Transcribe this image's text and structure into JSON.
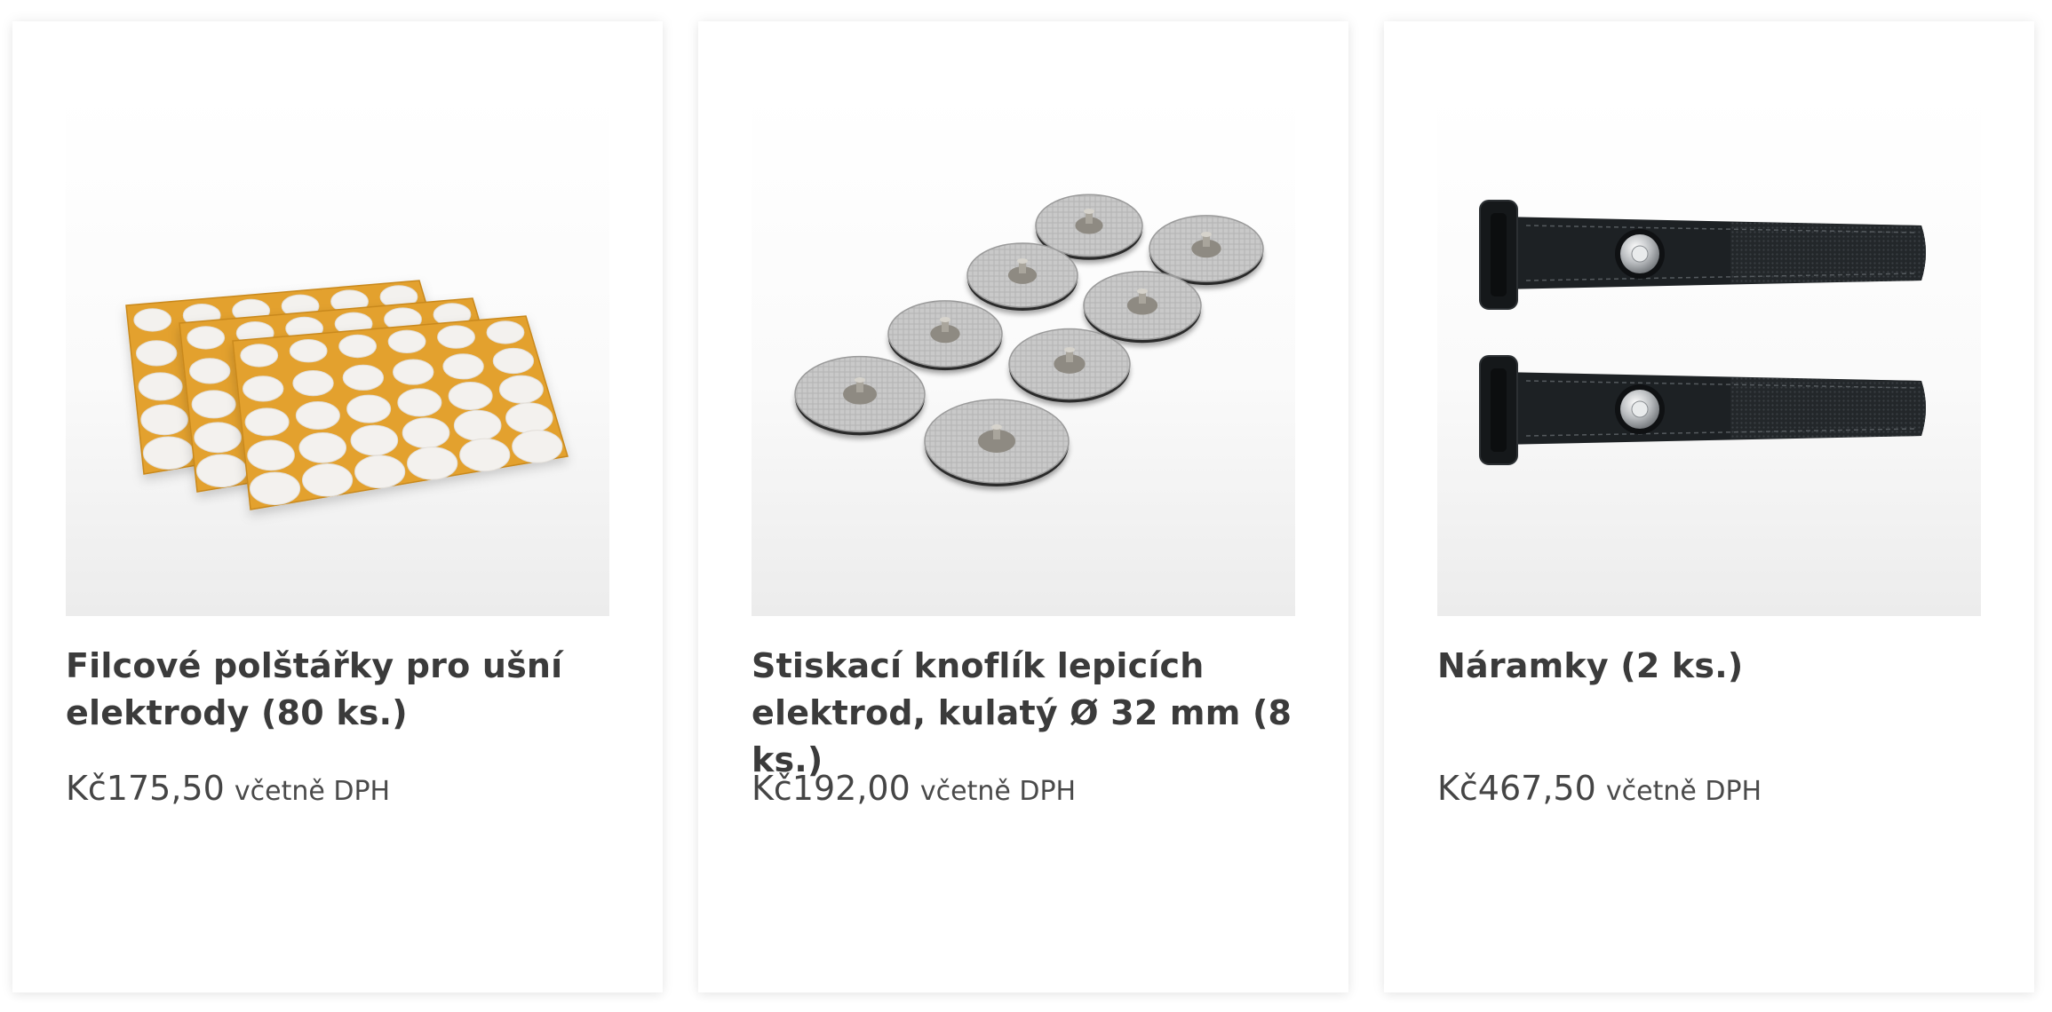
{
  "products": [
    {
      "title": "Filcové polštářky pro ušní elektrody (80 ks.)",
      "price": "Kč175,50",
      "vat_note": "včetně DPH",
      "image": "felt-pads-sheets"
    },
    {
      "title": "Stiskací knoflík lepicích elektrod, kulatý Ø 32 mm (8 ks.)",
      "price": "Kč192,00",
      "vat_note": "včetně DPH",
      "image": "round-snap-electrodes"
    },
    {
      "title": "Náramky (2 ks.)",
      "price": "Kč467,50",
      "vat_note": "včetně DPH",
      "image": "velcro-wristbands"
    }
  ],
  "colors": {
    "text": "#3b3b3b",
    "sheet_orange": "#e3a12f",
    "felt_white": "#f3f1ee",
    "electrode_grey": "#c9c9c9",
    "strap_black": "#1d2124"
  }
}
